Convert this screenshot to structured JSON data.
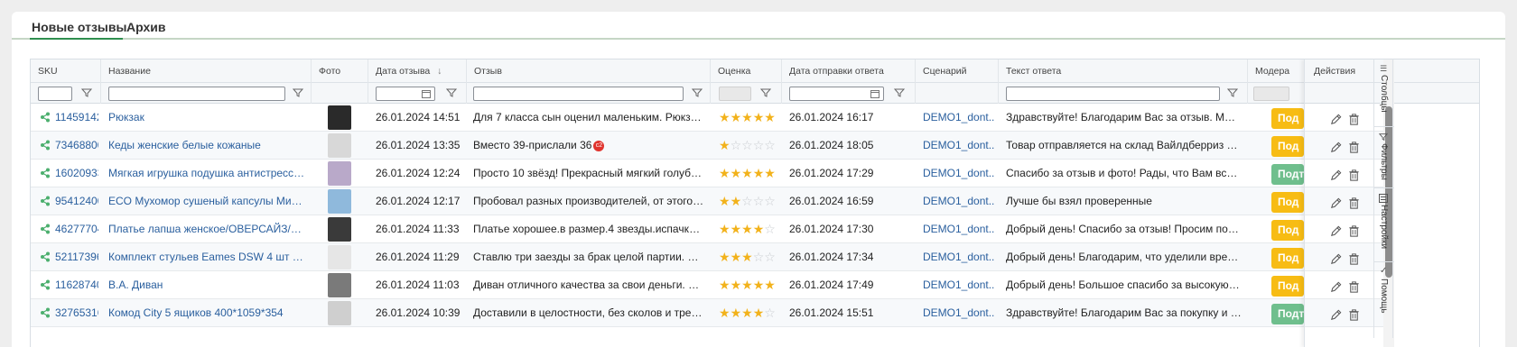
{
  "tabs": [
    {
      "label": "Новые отзывы",
      "active": true
    },
    {
      "label": "Архив",
      "active": false
    }
  ],
  "columns": {
    "sku": "SKU",
    "name": "Название",
    "photo": "Фото",
    "review_date": "Дата отзыва",
    "review": "Отзыв",
    "rating": "Оценка",
    "reply_date": "Дата отправки ответа",
    "scenario": "Сценарий",
    "reply_text": "Текст ответа",
    "moderation": "Модера",
    "actions": "Действия"
  },
  "sort_indicator": "↓",
  "side_tabs": [
    "Столбцы",
    "Фильтры",
    "Настройки",
    "Помощь"
  ],
  "rows": [
    {
      "sku": "11459142(",
      "name": "Рюкзак",
      "date": "26.01.2024 14:51",
      "review": "Для 7 класса сын оценил маленьким. Рюкзак хо...",
      "rating": 5,
      "reply_date": "26.01.2024 16:17",
      "scenario": "DEMO1_dont...",
      "reply": "Здравствуйте! Благодарим Вас за отзыв. Мы оче...",
      "moderation": "Под",
      "mod_color": "#f7bc14",
      "thumb": "#2a2a2a"
    },
    {
      "sku": "73468800",
      "name": "Кеды женские белые кожаные",
      "date": "26.01.2024 13:35",
      "review": "Вместо 39-прислали 36",
      "review_badge": "c2",
      "rating": 1,
      "reply_date": "26.01.2024 18:05",
      "scenario": "DEMO1_dont...",
      "reply": "Товар отправляется на склад Вайлдберриз полн...",
      "moderation": "Под",
      "mod_color": "#f7bc14",
      "thumb": "#d8d8d8"
    },
    {
      "sku": "16020933",
      "name": "Мягкая игрушка подушка антистресс / п...",
      "date": "26.01.2024 12:24",
      "review": "Просто 10 звёзд! Прекрасный мягкий голубь. Бо...",
      "rating": 5,
      "reply_date": "26.01.2024 17:29",
      "scenario": "DEMO1_dont...",
      "reply": "Спасибо за отзыв и фото! Рады, что Вам все пон...",
      "moderation": "Подт",
      "mod_color": "#6fbf8d",
      "thumb": "#b9a9c9"
    },
    {
      "sku": "95412400",
      "name": "ECO Мухомор сушеный капсулы Микрод...",
      "date": "26.01.2024 12:17",
      "review": "Пробовал разных производителей, от этого дей...",
      "rating": 2,
      "reply_date": "26.01.2024 16:59",
      "scenario": "DEMO1_dont...",
      "reply": "Лучше бы взял проверенные",
      "moderation": "Под",
      "mod_color": "#f7bc14",
      "thumb": "#8fb9dc"
    },
    {
      "sku": "46277704",
      "name": "Платье лапша женское/ОВЕРСАЙЗ/Вече...",
      "date": "26.01.2024 11:33",
      "review": "Платье хорошее.в размер.4 звезды.испачканный...",
      "rating": 4,
      "reply_date": "26.01.2024 17:30",
      "scenario": "DEMO1_dont...",
      "reply": "Добрый день! Спасибо за отзыв! Просим поним...",
      "moderation": "Под",
      "mod_color": "#f7bc14",
      "thumb": "#3a3a3a"
    },
    {
      "sku": "52117396",
      "name": "Комплект стульев Eames DSW 4 шт для к...",
      "date": "26.01.2024 11:29",
      "review": "Ставлю три заезды за брак целой партии. Перед...",
      "rating": 3,
      "reply_date": "26.01.2024 17:34",
      "scenario": "DEMO1_dont...",
      "reply": "Добрый день! Благодарим, что уделили время и ...",
      "moderation": "Под",
      "mod_color": "#f7bc14",
      "thumb": "#e6e6e6"
    },
    {
      "sku": "11628740'",
      "name": "В.А. Диван",
      "date": "26.01.2024 11:03",
      "review": "Диван отличного качества за свои деньги. При п...",
      "rating": 5,
      "reply_date": "26.01.2024 17:49",
      "scenario": "DEMO1_dont...",
      "reply": "Добрый день! Большое спасибо за высокую и ч...",
      "moderation": "Под",
      "mod_color": "#f7bc14",
      "thumb": "#7a7a7a"
    },
    {
      "sku": "32765316",
      "name": "Комод City 5 ящиков 400*1059*354",
      "date": "26.01.2024 10:39",
      "review": "Доставили в целостности, без сколов и трещин. ...",
      "rating": 4,
      "reply_date": "26.01.2024 15:51",
      "scenario": "DEMO1_dont...",
      "reply": "Здравствуйте! Благодарим Вас за покупку и хор...",
      "moderation": "Подт",
      "mod_color": "#6fbf8d",
      "thumb": "#cfcfcf"
    }
  ]
}
